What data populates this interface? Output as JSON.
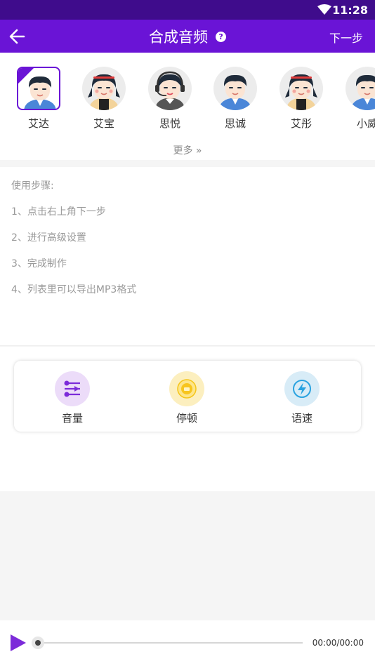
{
  "status_bar": {
    "time": "11:28"
  },
  "app_bar": {
    "title": "合成音频",
    "help_symbol": "?",
    "next_label": "下一步"
  },
  "voices": [
    {
      "name": "艾达",
      "style": "boy",
      "selected": true
    },
    {
      "name": "艾宝",
      "style": "girl",
      "selected": false
    },
    {
      "name": "思悦",
      "style": "headset",
      "selected": false
    },
    {
      "name": "思诚",
      "style": "boy",
      "selected": false
    },
    {
      "name": "艾彤",
      "style": "girl",
      "selected": false
    },
    {
      "name": "小威",
      "style": "boy",
      "selected": false
    }
  ],
  "more_label": "更多 »",
  "steps": {
    "heading": "使用步骤:",
    "items": [
      "1、点击右上角下一步",
      "2、进行高级设置",
      "3、完成制作",
      "4、列表里可以导出MP3格式"
    ]
  },
  "tools": [
    {
      "label": "音量",
      "icon": "sliders-icon",
      "bg": "#ecdcf9"
    },
    {
      "label": "停顿",
      "icon": "pause-icon",
      "bg": "#fcefbf"
    },
    {
      "label": "语速",
      "icon": "lightning-icon",
      "bg": "#d8ecf7"
    }
  ],
  "player": {
    "time": "00:00/00:00",
    "progress": 0
  },
  "colors": {
    "primary": "#6a14d6",
    "status_bar": "#3f0c8c",
    "play": "#7c2bd9"
  }
}
